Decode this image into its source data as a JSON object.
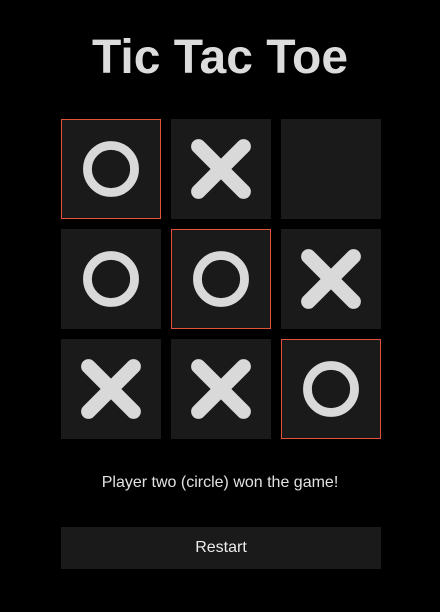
{
  "game": {
    "title": "Tic Tac Toe",
    "status": "Player two (circle) won the game!",
    "restart_label": "Restart"
  },
  "board": {
    "cells": [
      {
        "mark": "O",
        "winning": true
      },
      {
        "mark": "X",
        "winning": false
      },
      {
        "mark": "",
        "winning": false
      },
      {
        "mark": "O",
        "winning": false
      },
      {
        "mark": "O",
        "winning": true
      },
      {
        "mark": "X",
        "winning": false
      },
      {
        "mark": "X",
        "winning": false
      },
      {
        "mark": "X",
        "winning": false
      },
      {
        "mark": "O",
        "winning": true
      }
    ]
  },
  "colors": {
    "background": "#000000",
    "cell": "#1a1a1a",
    "mark": "#d9d9d9",
    "win_border": "#e0523a"
  }
}
